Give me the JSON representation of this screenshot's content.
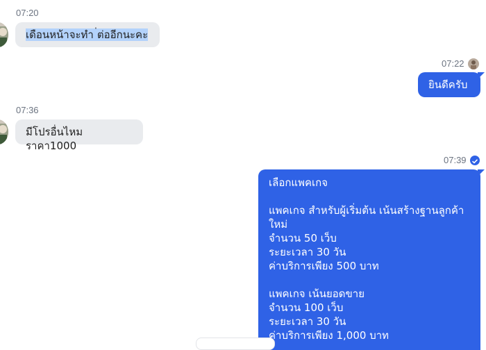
{
  "messages": [
    {
      "side": "in",
      "time": "07:20",
      "text": "เดือนหน้าจะทำ ่ต่ออีกนะคะ",
      "selected": true
    },
    {
      "side": "out",
      "time": "07:22",
      "text": "ยินดีครับ"
    },
    {
      "side": "in",
      "time": "07:36",
      "text": "มีโปรอื่นไหมราคา1000"
    },
    {
      "side": "out",
      "time": "07:39",
      "text": "เลือกแพคเกจ\n\nแพคเกจ สำหรับผู้เริ่มต้น เน้นสร้างฐานลูกค้า\nใหม่\nจำนวน 50 เว็บ\nระยะเวลา 30 วัน\nค่าบริการเพียง 500 บาท\n\nแพคเกจ เน้นยอดขาย\nจำนวน 100 เว็บ\nระยะเวลา 30 วัน\nค่าบริการเพียง 1,000 บาท"
    }
  ],
  "icons": {
    "read_receipt": "check-circle-icon",
    "sender_avatar": "avatar",
    "user_avatar": "avatar"
  },
  "colors": {
    "outgoing_bubble": "#2f62e6",
    "incoming_bubble": "#e9ebee",
    "timestamp": "#6b7380",
    "selection": "#b3d2fb"
  }
}
